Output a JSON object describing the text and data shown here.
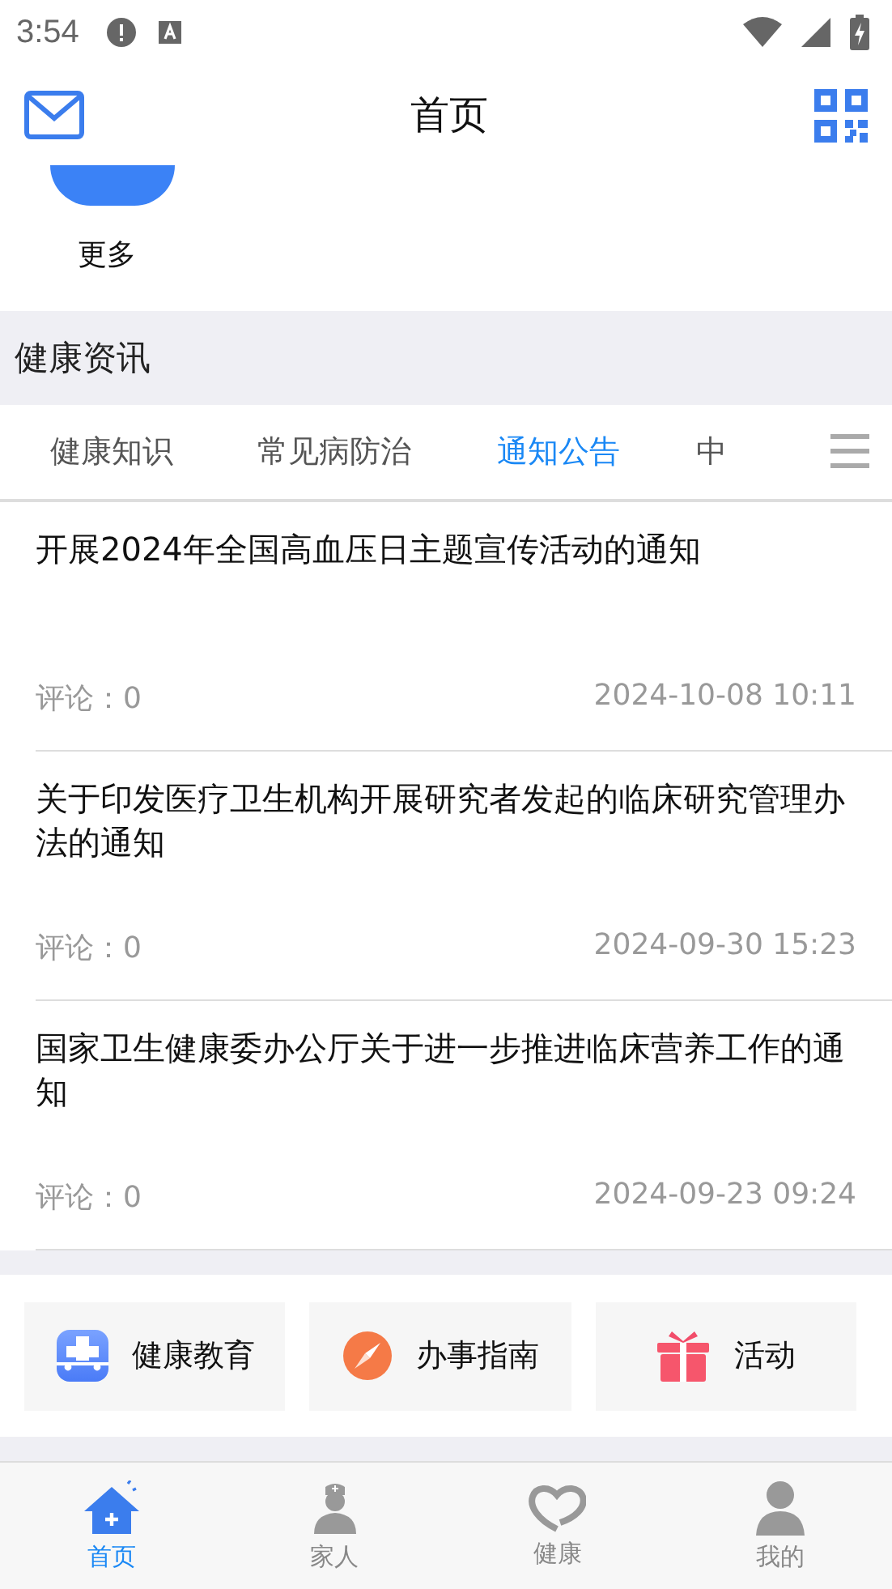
{
  "status_bar": {
    "time": "3:54"
  },
  "header": {
    "title": "首页"
  },
  "more_item": {
    "label": "更多"
  },
  "section": {
    "title": "健康资讯"
  },
  "tabs": [
    {
      "label": "健康知识",
      "selected": false
    },
    {
      "label": "常见病防治",
      "selected": false
    },
    {
      "label": "通知公告",
      "selected": true
    },
    {
      "label": "中",
      "selected": false
    }
  ],
  "articles": [
    {
      "title": "开展2024年全国高血压日主题宣传活动的通知",
      "comments": "评论：0",
      "date": "2024-10-08 10:11"
    },
    {
      "title": "关于印发医疗卫生机构开展研究者发起的临床研究管理办法的通知",
      "comments": "评论：0",
      "date": "2024-09-30 15:23"
    },
    {
      "title": "国家卫生健康委办公厅关于进一步推进临床营养工作的通知",
      "comments": "评论：0",
      "date": "2024-09-23 09:24"
    }
  ],
  "shortcuts": [
    {
      "kind": "education",
      "label": "健康教育"
    },
    {
      "kind": "guide",
      "label": "办事指南"
    },
    {
      "kind": "activity",
      "label": "活动"
    }
  ],
  "bottom_nav": [
    {
      "kind": "home",
      "label": "首页",
      "selected": true
    },
    {
      "kind": "family",
      "label": "家人",
      "selected": false
    },
    {
      "kind": "health",
      "label": "健康",
      "selected": false
    },
    {
      "kind": "me",
      "label": "我的",
      "selected": false
    }
  ]
}
